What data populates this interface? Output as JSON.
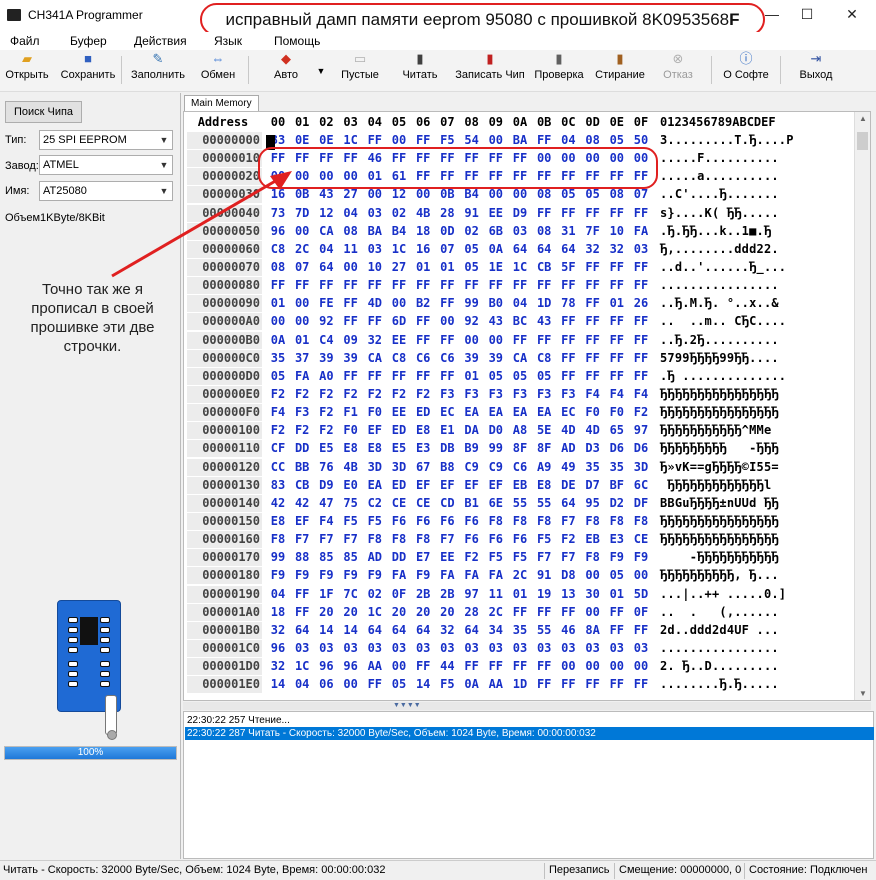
{
  "window": {
    "title": "CH341A Programmer",
    "minimize": "—",
    "maximize": "☐",
    "close": "✕"
  },
  "annotation_top": {
    "text": "исправный дамп памяти eeprom 95080 с прошивкой 8K0953568",
    "bold_suffix": "F"
  },
  "menu": [
    "Файл",
    "Буфер",
    "Действия",
    "Язык",
    "Помощь"
  ],
  "toolbar": {
    "open": "Открыть",
    "save": "Сохранить",
    "fill": "Заполнить",
    "swap": "Обмен",
    "auto": "Авто",
    "blank": "Пустые",
    "read": "Читать",
    "write": "Записать Чип",
    "verify": "Проверка",
    "erase": "Стирание",
    "cancel": "Отказ",
    "about": "О Софте",
    "exit": "Выход"
  },
  "left": {
    "search_button": "Поиск Чипа",
    "type_label": "Тип:",
    "type_value": "25 SPI EEPROM",
    "maker_label": "Завод:",
    "maker_value": "ATMEL",
    "name_label": "Имя:",
    "name_value": "AT25080",
    "volume_text": "Объем1KByte/8KBit",
    "note": "Точно так же я прописал в своей прошивке эти две строчки.",
    "progress_percent": 100,
    "progress_label": "100%"
  },
  "tab": "Main Memory",
  "hex": {
    "address_header": "Address",
    "columns": [
      "00",
      "01",
      "02",
      "03",
      "04",
      "05",
      "06",
      "07",
      "08",
      "09",
      "0A",
      "0B",
      "0C",
      "0D",
      "0E",
      "0F"
    ],
    "ascii_header": "0123456789ABCDEF",
    "rows": [
      {
        "addr": "00000000",
        "bytes": [
          "33",
          "0E",
          "0E",
          "1C",
          "FF",
          "00",
          "FF",
          "F5",
          "54",
          "00",
          "BA",
          "FF",
          "04",
          "08",
          "05",
          "50"
        ],
        "ascii": "3.........T.Ђ....P"
      },
      {
        "addr": "00000010",
        "bytes": [
          "FF",
          "FF",
          "FF",
          "FF",
          "46",
          "FF",
          "FF",
          "FF",
          "FF",
          "FF",
          "FF",
          "00",
          "00",
          "00",
          "00",
          "00"
        ],
        "ascii": ".....F.........."
      },
      {
        "addr": "00000020",
        "bytes": [
          "00",
          "00",
          "00",
          "00",
          "01",
          "61",
          "FF",
          "FF",
          "FF",
          "FF",
          "FF",
          "FF",
          "FF",
          "FF",
          "FF",
          "FF"
        ],
        "ascii": ".....a.........."
      },
      {
        "addr": "00000030",
        "bytes": [
          "16",
          "0B",
          "43",
          "27",
          "00",
          "12",
          "00",
          "0B",
          "B4",
          "00",
          "00",
          "08",
          "05",
          "05",
          "08",
          "07"
        ],
        "ascii": "..C'....Ђ......."
      },
      {
        "addr": "00000040",
        "bytes": [
          "73",
          "7D",
          "12",
          "04",
          "03",
          "02",
          "4B",
          "28",
          "91",
          "EE",
          "D9",
          "FF",
          "FF",
          "FF",
          "FF",
          "FF"
        ],
        "ascii": "s}....K( ЂЂ....."
      },
      {
        "addr": "00000050",
        "bytes": [
          "96",
          "00",
          "CA",
          "08",
          "BA",
          "B4",
          "18",
          "0D",
          "02",
          "6B",
          "03",
          "08",
          "31",
          "7F",
          "10",
          "FA"
        ],
        "ascii": ".Ђ.ЂЂ...k..1■.Ђ"
      },
      {
        "addr": "00000060",
        "bytes": [
          "C8",
          "2C",
          "04",
          "11",
          "03",
          "1C",
          "16",
          "07",
          "05",
          "0A",
          "64",
          "64",
          "64",
          "32",
          "32",
          "03"
        ],
        "ascii": "Ђ,........ddd22."
      },
      {
        "addr": "00000070",
        "bytes": [
          "08",
          "07",
          "64",
          "00",
          "10",
          "27",
          "01",
          "01",
          "05",
          "1E",
          "1C",
          "CB",
          "5F",
          "FF",
          "FF",
          "FF"
        ],
        "ascii": "..d..'......Ђ_..."
      },
      {
        "addr": "00000080",
        "bytes": [
          "FF",
          "FF",
          "FF",
          "FF",
          "FF",
          "FF",
          "FF",
          "FF",
          "FF",
          "FF",
          "FF",
          "FF",
          "FF",
          "FF",
          "FF",
          "FF"
        ],
        "ascii": "................"
      },
      {
        "addr": "00000090",
        "bytes": [
          "01",
          "00",
          "FE",
          "FF",
          "4D",
          "00",
          "B2",
          "FF",
          "99",
          "B0",
          "04",
          "1D",
          "78",
          "FF",
          "01",
          "26"
        ],
        "ascii": "..Ђ.M.Ђ. °..x..&"
      },
      {
        "addr": "000000A0",
        "bytes": [
          "00",
          "00",
          "92",
          "FF",
          "FF",
          "6D",
          "FF",
          "00",
          "92",
          "43",
          "BC",
          "43",
          "FF",
          "FF",
          "FF",
          "FF"
        ],
        "ascii": "..  ..m.. CЂC...."
      },
      {
        "addr": "000000B0",
        "bytes": [
          "0A",
          "01",
          "C4",
          "09",
          "32",
          "EE",
          "FF",
          "FF",
          "00",
          "00",
          "FF",
          "FF",
          "FF",
          "FF",
          "FF",
          "FF"
        ],
        "ascii": "..Ђ.2Ђ.........."
      },
      {
        "addr": "000000C0",
        "bytes": [
          "35",
          "37",
          "39",
          "39",
          "CA",
          "C8",
          "C6",
          "C6",
          "39",
          "39",
          "CA",
          "C8",
          "FF",
          "FF",
          "FF",
          "FF"
        ],
        "ascii": "5799ЂЂЂЂ99ЂЂ...."
      },
      {
        "addr": "000000D0",
        "bytes": [
          "05",
          "FA",
          "A0",
          "FF",
          "FF",
          "FF",
          "FF",
          "FF",
          "01",
          "05",
          "05",
          "05",
          "FF",
          "FF",
          "FF",
          "FF"
        ],
        "ascii": ".Ђ .............."
      },
      {
        "addr": "000000E0",
        "bytes": [
          "F2",
          "F2",
          "F2",
          "F2",
          "F2",
          "F2",
          "F2",
          "F3",
          "F3",
          "F3",
          "F3",
          "F3",
          "F3",
          "F4",
          "F4",
          "F4"
        ],
        "ascii": "ЂЂЂЂЂЂЂЂЂЂЂЂЂЂЂЂ"
      },
      {
        "addr": "000000F0",
        "bytes": [
          "F4",
          "F3",
          "F2",
          "F1",
          "F0",
          "EE",
          "ED",
          "EC",
          "EA",
          "EA",
          "EA",
          "EA",
          "EC",
          "F0",
          "F0",
          "F2"
        ],
        "ascii": "ЂЂЂЂЂЂЂЂЂЂЂЂЂЂЂЂ"
      },
      {
        "addr": "00000100",
        "bytes": [
          "F2",
          "F2",
          "F2",
          "F0",
          "EF",
          "ED",
          "E8",
          "E1",
          "DA",
          "D0",
          "A8",
          "5E",
          "4D",
          "4D",
          "65",
          "97"
        ],
        "ascii": "ЂЂЂЂЂЂЂЂЂЂЂ^MMe"
      },
      {
        "addr": "00000110",
        "bytes": [
          "CF",
          "DD",
          "E5",
          "E8",
          "E8",
          "E5",
          "E3",
          "DB",
          "B9",
          "99",
          "8F",
          "8F",
          "AD",
          "D3",
          "D6",
          "D6"
        ],
        "ascii": "ЂЂЂЂЂЂЂЂЂ   -ЂЂЂ"
      },
      {
        "addr": "00000120",
        "bytes": [
          "CC",
          "BB",
          "76",
          "4B",
          "3D",
          "3D",
          "67",
          "B8",
          "C9",
          "C9",
          "C6",
          "A9",
          "49",
          "35",
          "35",
          "3D"
        ],
        "ascii": "Ђ»vK==gЂЂЂЂ©I55="
      },
      {
        "addr": "00000130",
        "bytes": [
          "83",
          "CB",
          "D9",
          "E0",
          "EA",
          "ED",
          "EF",
          "EF",
          "EF",
          "EF",
          "EB",
          "E8",
          "DE",
          "D7",
          "BF",
          "6C"
        ],
        "ascii": " ЂЂЂЂЂЂЂЂЂЂЂЂЂl"
      },
      {
        "addr": "00000140",
        "bytes": [
          "42",
          "42",
          "47",
          "75",
          "C2",
          "CE",
          "CE",
          "CD",
          "B1",
          "6E",
          "55",
          "55",
          "64",
          "95",
          "D2",
          "DF"
        ],
        "ascii": "BBGuЂЂЂЂ±nUUd ЂЂ"
      },
      {
        "addr": "00000150",
        "bytes": [
          "E8",
          "EF",
          "F4",
          "F5",
          "F5",
          "F6",
          "F6",
          "F6",
          "F6",
          "F8",
          "F8",
          "F8",
          "F7",
          "F8",
          "F8",
          "F8"
        ],
        "ascii": "ЂЂЂЂЂЂЂЂЂЂЂЂЂЂЂЂ"
      },
      {
        "addr": "00000160",
        "bytes": [
          "F8",
          "F7",
          "F7",
          "F7",
          "F8",
          "F8",
          "F8",
          "F7",
          "F6",
          "F6",
          "F6",
          "F5",
          "F2",
          "EB",
          "E3",
          "CE"
        ],
        "ascii": "ЂЂЂЂЂЂЂЂЂЂЂЂЂЂЂЂ"
      },
      {
        "addr": "00000170",
        "bytes": [
          "99",
          "88",
          "85",
          "85",
          "AD",
          "DD",
          "E7",
          "EE",
          "F2",
          "F5",
          "F5",
          "F7",
          "F7",
          "F8",
          "F9",
          "F9"
        ],
        "ascii": "    -ЂЂЂЂЂЂЂЂЂЂЂ"
      },
      {
        "addr": "00000180",
        "bytes": [
          "F9",
          "F9",
          "F9",
          "F9",
          "F9",
          "FA",
          "F9",
          "FA",
          "FA",
          "FA",
          "2C",
          "91",
          "D8",
          "00",
          "05",
          "00"
        ],
        "ascii": "ЂЂЂЂЂЂЂЂЂЂ, Ђ..."
      },
      {
        "addr": "00000190",
        "bytes": [
          "04",
          "FF",
          "1F",
          "7C",
          "02",
          "0F",
          "2B",
          "2B",
          "97",
          "11",
          "01",
          "19",
          "13",
          "30",
          "01",
          "5D"
        ],
        "ascii": "...|..++ .....0.]"
      },
      {
        "addr": "000001A0",
        "bytes": [
          "18",
          "FF",
          "20",
          "20",
          "1C",
          "20",
          "20",
          "20",
          "28",
          "2C",
          "FF",
          "FF",
          "FF",
          "00",
          "FF",
          "0F"
        ],
        "ascii": "..  .   (,......"
      },
      {
        "addr": "000001B0",
        "bytes": [
          "32",
          "64",
          "14",
          "14",
          "64",
          "64",
          "64",
          "32",
          "64",
          "34",
          "35",
          "55",
          "46",
          "8A",
          "FF",
          "FF"
        ],
        "ascii": "2d..ddd2d4UF ..."
      },
      {
        "addr": "000001C0",
        "bytes": [
          "96",
          "03",
          "03",
          "03",
          "03",
          "03",
          "03",
          "03",
          "03",
          "03",
          "03",
          "03",
          "03",
          "03",
          "03",
          "03"
        ],
        "ascii": "................"
      },
      {
        "addr": "000001D0",
        "bytes": [
          "32",
          "1C",
          "96",
          "96",
          "AA",
          "00",
          "FF",
          "44",
          "FF",
          "FF",
          "FF",
          "FF",
          "00",
          "00",
          "00",
          "00"
        ],
        "ascii": "2. Ђ..D........."
      },
      {
        "addr": "000001E0",
        "bytes": [
          "14",
          "04",
          "06",
          "00",
          "FF",
          "05",
          "14",
          "F5",
          "0A",
          "AA",
          "1D",
          "FF",
          "FF",
          "FF",
          "FF",
          "FF"
        ],
        "ascii": "........Ђ.Ђ....."
      }
    ]
  },
  "log": [
    "22:30:22 257 Чтение...",
    "22:30:22 287 Читать - Скорость: 32000 Byte/Sec, Объем: 1024 Byte, Время: 00:00:00:032"
  ],
  "status": {
    "main": "Читать - Скорость: 32000 Byte/Sec, Объем: 1024 Byte, Время: 00:00:00:032",
    "mode": "Перезапись",
    "offset": "Смещение: 00000000, 0",
    "state": "Состояние: Подключен"
  }
}
